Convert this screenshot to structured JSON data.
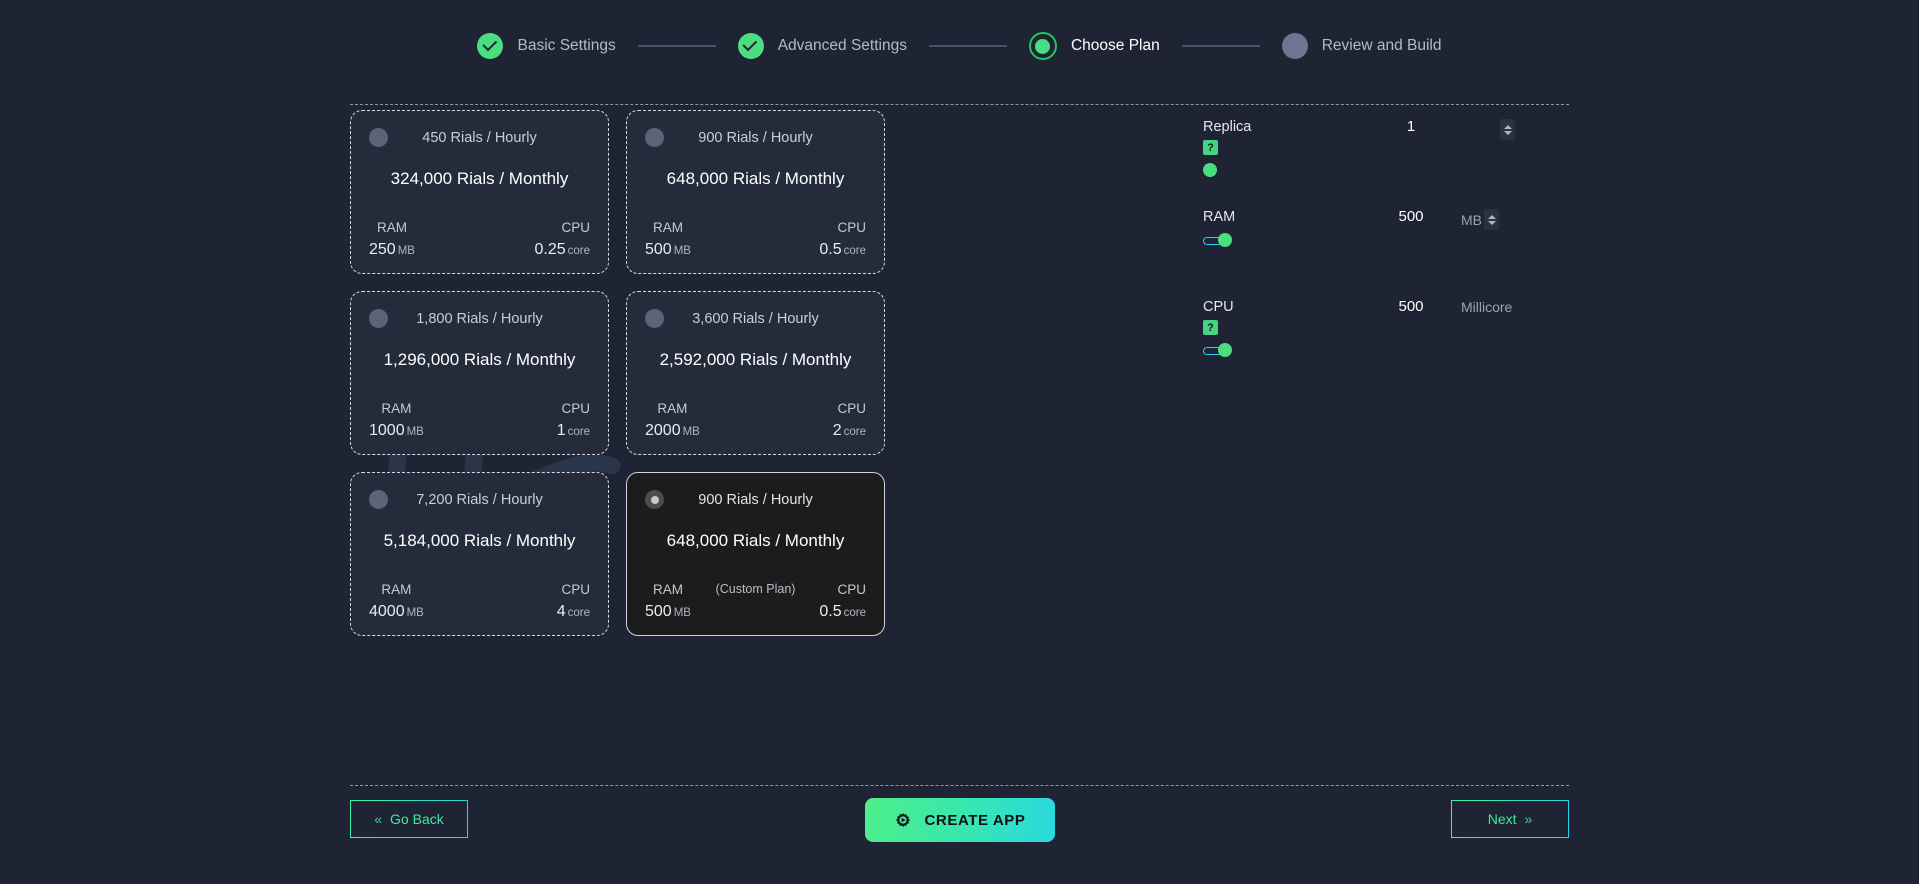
{
  "stepper": {
    "steps": [
      {
        "label": "Basic Settings",
        "state": "done"
      },
      {
        "label": "Advanced Settings",
        "state": "done"
      },
      {
        "label": "Choose Plan",
        "state": "active"
      },
      {
        "label": "Review and Build",
        "state": "pending"
      }
    ]
  },
  "plans": [
    {
      "hourly": "450 Rials / Hourly",
      "monthly": "324,000 Rials / Monthly",
      "ram_key": "RAM",
      "ram_val": "250",
      "ram_unit": "MB",
      "cpu_key": "CPU",
      "cpu_val": "0.25",
      "cpu_unit": "core",
      "selected": false,
      "tag": ""
    },
    {
      "hourly": "900 Rials / Hourly",
      "monthly": "648,000 Rials / Monthly",
      "ram_key": "RAM",
      "ram_val": "500",
      "ram_unit": "MB",
      "cpu_key": "CPU",
      "cpu_val": "0.5",
      "cpu_unit": "core",
      "selected": false,
      "tag": ""
    },
    {
      "hourly": "1,800 Rials / Hourly",
      "monthly": "1,296,000 Rials / Monthly",
      "ram_key": "RAM",
      "ram_val": "1000",
      "ram_unit": "MB",
      "cpu_key": "CPU",
      "cpu_val": "1",
      "cpu_unit": "core",
      "selected": false,
      "tag": ""
    },
    {
      "hourly": "3,600 Rials / Hourly",
      "monthly": "2,592,000 Rials / Monthly",
      "ram_key": "RAM",
      "ram_val": "2000",
      "ram_unit": "MB",
      "cpu_key": "CPU",
      "cpu_val": "2",
      "cpu_unit": "core",
      "selected": false,
      "tag": ""
    },
    {
      "hourly": "7,200 Rials / Hourly",
      "monthly": "5,184,000 Rials / Monthly",
      "ram_key": "RAM",
      "ram_val": "4000",
      "ram_unit": "MB",
      "cpu_key": "CPU",
      "cpu_val": "4",
      "cpu_unit": "core",
      "selected": false,
      "tag": ""
    },
    {
      "hourly": "900 Rials / Hourly",
      "monthly": "648,000 Rials / Monthly",
      "ram_key": "RAM",
      "ram_val": "500",
      "ram_unit": "MB",
      "cpu_key": "CPU",
      "cpu_val": "0.5",
      "cpu_unit": "core",
      "selected": true,
      "tag": "(Custom Plan)"
    }
  ],
  "config": {
    "replica": {
      "label": "Replica",
      "help": "?",
      "value": "1",
      "unit": ""
    },
    "ram": {
      "label": "RAM",
      "help": "?",
      "value": "500",
      "unit": "MB"
    },
    "cpu": {
      "label": "CPU",
      "help": "?",
      "value": "500",
      "unit": "Millicore"
    }
  },
  "footer": {
    "go_back": "Go Back",
    "go_back_chevron": "«",
    "create_app": "CREATE APP",
    "next": "Next",
    "next_chevron": "»"
  },
  "colors": {
    "accent_green": "#4ade80",
    "accent_cyan": "#22d3ee",
    "background": "#1e2433",
    "card": "#242b3b",
    "card_selected": "#1c1c1c"
  }
}
